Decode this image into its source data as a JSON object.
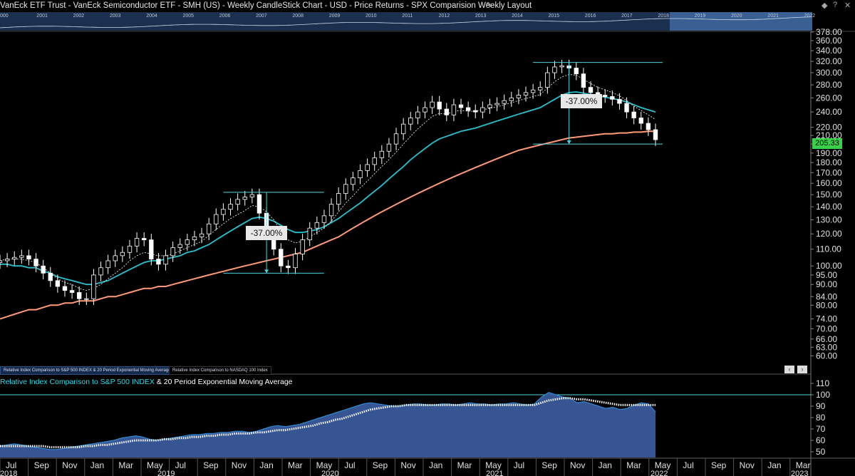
{
  "window": {
    "title": "VanEck ETF Trust - VanEck Semiconductor ETF - SMH (US) - Weekly CandleStick Chart - USD - Price Returns - SPX Comparision Weekly Layout",
    "edit_icon": "pencil-icon",
    "buttons": [
      "diamond-icon",
      "help-icon",
      "close-icon"
    ]
  },
  "navigator": {
    "years": [
      "000",
      "2001",
      "2002",
      "2003",
      "2004",
      "2005",
      "2006",
      "2007",
      "2008",
      "2009",
      "2010",
      "2011",
      "2012",
      "2013",
      "2014",
      "2015",
      "2016",
      "2017",
      "2018",
      "2019",
      "2020",
      "2021",
      "2022"
    ]
  },
  "tabs": [
    {
      "label": "Relative Index Comparison to S&P 500 INDEX & 20 Period Exponential Moving Average"
    },
    {
      "label": "Relative Index Comparison to NASDAQ 100 Index"
    }
  ],
  "subchart": {
    "title_colored": "Relative Index Comparison to S&P 500 INDEX",
    "title_rest": " & 20 Period Exponential Moving Average"
  },
  "price_tag": "205.33",
  "annotations": [
    "-37.00%",
    "-37.00%"
  ],
  "scroll": {
    "left": "‹",
    "right": "›"
  },
  "colors": {
    "candle": "#ffffff",
    "ema_fast": "#ffffff",
    "ema_mid": "#27c1cf",
    "ema_slow": "#ff9a78",
    "relative_area": "#3a5a9a",
    "relative_line": "#2f8bd6",
    "price_tag": "#3ad14a",
    "reference_lines": "#4fd5e0"
  },
  "chart_data": [
    {
      "type": "candlestick",
      "scale": "log",
      "ylim": [
        57,
        378
      ],
      "y_ticks": [
        "378.00",
        "360.00",
        "340.00",
        "320.00",
        "300.00",
        "280.00",
        "260.00",
        "240.00",
        "220.00",
        "210.00",
        "200.00",
        "190.00",
        "180.00",
        "170.00",
        "160.00",
        "150.00",
        "140.00",
        "130.00",
        "120.00",
        "110.00",
        "100.00",
        "95.00",
        "90.00",
        "84.00",
        "80.00",
        "74.00",
        "70.00",
        "66.00",
        "63.00",
        "60.00"
      ],
      "x_ticks": [
        "Jul",
        "Sep",
        "Nov",
        "Jan",
        "Mar",
        "May",
        "Jul",
        "Sep",
        "Nov",
        "Jan",
        "Mar",
        "May",
        "Jul",
        "Sep",
        "Nov",
        "Jan",
        "Mar",
        "May",
        "Jul",
        "Sep",
        "Nov",
        "Jan",
        "Mar",
        "May",
        "Jul",
        "Sep",
        "Nov",
        "Jan",
        "Mar"
      ],
      "x_years": [
        "2018",
        "2019",
        "2020",
        "2021",
        "2022",
        "2023"
      ],
      "last_price": 205.33,
      "close_series": [
        103,
        104,
        105,
        106,
        104,
        100,
        96,
        92,
        89,
        87,
        86,
        83,
        83,
        95,
        99,
        103,
        106,
        108,
        112,
        117,
        116,
        104,
        101,
        106,
        111,
        113,
        116,
        118,
        120,
        127,
        134,
        138,
        142,
        146,
        148,
        150,
        135,
        120,
        110,
        100,
        99,
        107,
        116,
        124,
        128,
        133,
        142,
        151,
        159,
        165,
        172,
        178,
        185,
        192,
        200,
        212,
        224,
        232,
        240,
        246,
        254,
        244,
        236,
        250,
        246,
        242,
        240,
        246,
        250,
        252,
        256,
        260,
        264,
        268,
        272,
        276,
        300,
        310,
        312,
        308,
        298,
        276,
        268,
        264,
        262,
        258,
        252,
        240,
        232,
        225,
        217,
        205
      ],
      "ema_fast": [
        103,
        104,
        104,
        104,
        103,
        102,
        99,
        96,
        93,
        91,
        90,
        88,
        87,
        88,
        90,
        93,
        96,
        99,
        103,
        106,
        108,
        107,
        106,
        106,
        107,
        109,
        111,
        113,
        115,
        119,
        123,
        127,
        131,
        134,
        137,
        141,
        140,
        136,
        130,
        122,
        116,
        114,
        115,
        118,
        121,
        124,
        129,
        136,
        143,
        149,
        156,
        162,
        169,
        176,
        183,
        191,
        200,
        209,
        218,
        226,
        234,
        238,
        237,
        241,
        242,
        241,
        241,
        243,
        245,
        247,
        250,
        253,
        256,
        259,
        262,
        265,
        275,
        285,
        293,
        297,
        296,
        289,
        282,
        276,
        272,
        268,
        263,
        256,
        248,
        242,
        236,
        230
      ],
      "ema_mid": [
        101,
        101,
        100,
        100,
        99,
        99,
        97,
        96,
        94,
        93,
        92,
        91,
        90,
        90,
        91,
        92,
        94,
        96,
        98,
        100,
        102,
        103,
        103,
        104,
        105,
        106,
        108,
        109,
        111,
        113,
        116,
        119,
        122,
        125,
        128,
        131,
        132,
        131,
        129,
        126,
        123,
        121,
        121,
        122,
        123,
        125,
        128,
        131,
        135,
        139,
        143,
        148,
        153,
        158,
        164,
        170,
        176,
        183,
        189,
        195,
        201,
        206,
        209,
        212,
        215,
        217,
        219,
        222,
        225,
        228,
        231,
        234,
        237,
        240,
        243,
        246,
        252,
        258,
        264,
        268,
        269,
        267,
        265,
        263,
        261,
        259,
        257,
        254,
        250,
        246,
        243,
        240
      ],
      "ema_slow": [
        74,
        75,
        76,
        77,
        78,
        78,
        79,
        80,
        80,
        81,
        81,
        82,
        82,
        82,
        83,
        84,
        84,
        85,
        86,
        87,
        88,
        88,
        89,
        89,
        90,
        91,
        92,
        93,
        94,
        95,
        96,
        97,
        98,
        99,
        100,
        101,
        102,
        103,
        104,
        105,
        106,
        107,
        108,
        110,
        112,
        114,
        116,
        118,
        121,
        124,
        127,
        130,
        133,
        136,
        139,
        142,
        145,
        148,
        151,
        154,
        157,
        160,
        163,
        166,
        169,
        172,
        175,
        178,
        181,
        184,
        187,
        190,
        193,
        195,
        197,
        199,
        201,
        203,
        205,
        207,
        208,
        209,
        210,
        211,
        212,
        212,
        213,
        213,
        214,
        214,
        215,
        215
      ],
      "drawdowns": [
        {
          "peak": 152,
          "trough": 96,
          "label": "-37.00%"
        },
        {
          "peak": 318,
          "trough": 200,
          "label": "-37.00%"
        }
      ]
    },
    {
      "type": "area",
      "title": "Relative Index Comparison to S&P 500 INDEX & 20 Period Exponential Moving Average",
      "ylim": [
        45,
        110
      ],
      "y_ticks": [
        "110",
        "100",
        "90",
        "80",
        "70",
        "60",
        "50"
      ],
      "reference_line": 100,
      "series": [
        {
          "name": "Relative Index Comparison to S&P 500 INDEX",
          "values": [
            55,
            56,
            57,
            56,
            55,
            54,
            53,
            52,
            52,
            53,
            54,
            55,
            56,
            57,
            58,
            59,
            60,
            62,
            63,
            64,
            63,
            61,
            60,
            61,
            62,
            63,
            64,
            65,
            65,
            66,
            66,
            67,
            67,
            68,
            68,
            67,
            68,
            70,
            72,
            73,
            72,
            73,
            74,
            76,
            78,
            80,
            82,
            84,
            86,
            88,
            90,
            92,
            93,
            92,
            91,
            90,
            90,
            91,
            92,
            92,
            91,
            91,
            92,
            92,
            91,
            92,
            93,
            92,
            92,
            91,
            92,
            92,
            93,
            92,
            91,
            92,
            98,
            102,
            100,
            98,
            97,
            93,
            94,
            92,
            90,
            88,
            89,
            87,
            88,
            91,
            93,
            92,
            85
          ]
        },
        {
          "name": "20 Period Exponential Moving Average",
          "values": [
            55,
            55,
            55,
            55,
            55,
            55,
            55,
            54,
            54,
            54,
            54,
            54,
            55,
            55,
            56,
            56,
            57,
            58,
            59,
            60,
            60,
            60,
            60,
            61,
            61,
            62,
            62,
            63,
            63,
            64,
            64,
            65,
            65,
            66,
            66,
            66,
            67,
            67,
            68,
            69,
            69,
            70,
            71,
            72,
            73,
            75,
            76,
            78,
            79,
            81,
            83,
            85,
            87,
            88,
            89,
            90,
            90,
            91,
            91,
            91,
            91,
            91,
            91,
            91,
            91,
            91,
            91,
            91,
            91,
            91,
            91,
            91,
            91,
            91,
            91,
            91,
            93,
            95,
            96,
            97,
            97,
            96,
            96,
            95,
            94,
            93,
            92,
            91,
            91,
            91,
            91,
            91,
            91
          ]
        }
      ]
    }
  ]
}
